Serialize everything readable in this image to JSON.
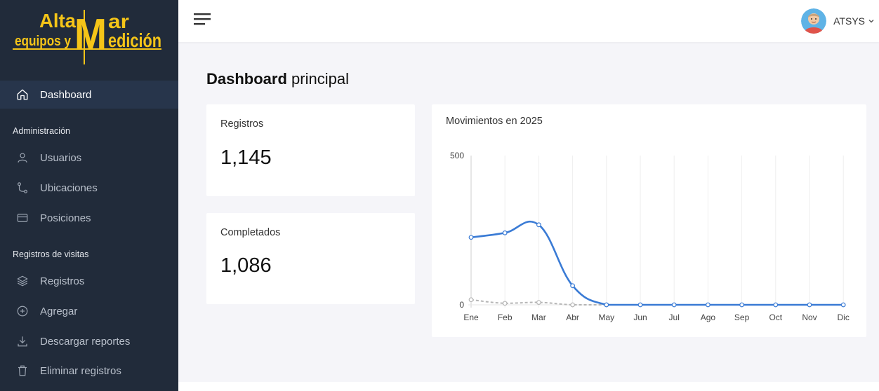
{
  "brand": {
    "line1": "Alta",
    "big_letter": "M",
    "line1_end": "ar",
    "line2_start": "equipos y",
    "line2_end": "edición",
    "color": "#f5c518"
  },
  "sidebar": {
    "items": [
      {
        "label": "Dashboard",
        "icon": "home-icon",
        "active": true
      },
      {
        "label": "Usuarios",
        "icon": "user-icon"
      },
      {
        "label": "Ubicaciones",
        "icon": "route-icon"
      },
      {
        "label": "Posiciones",
        "icon": "card-icon"
      },
      {
        "label": "Registros",
        "icon": "layers-icon"
      },
      {
        "label": "Agregar",
        "icon": "plus-circle-icon"
      },
      {
        "label": "Descargar reportes",
        "icon": "download-icon"
      },
      {
        "label": "Eliminar registros",
        "icon": "trash-icon"
      }
    ],
    "sections": {
      "admin": "Administración",
      "visits": "Registros de visitas"
    }
  },
  "header": {
    "user_name": "ATSYS"
  },
  "page": {
    "title_bold": "Dashboard",
    "title_rest": "principal"
  },
  "stats": {
    "registros": {
      "label": "Registros",
      "value": "1,145"
    },
    "completados": {
      "label": "Completados",
      "value": "1,086"
    }
  },
  "chart_data": {
    "type": "line",
    "title": "Movimientos en 2025",
    "categories": [
      "Ene",
      "Feb",
      "Mar",
      "Abr",
      "May",
      "Jun",
      "Jul",
      "Ago",
      "Sep",
      "Oct",
      "Nov",
      "Dic"
    ],
    "ylim": [
      0,
      500
    ],
    "yticks": [
      0,
      500
    ],
    "grid": true,
    "series": [
      {
        "values": [
          226,
          241,
          268,
          64,
          0,
          0,
          0,
          0,
          0,
          0,
          0,
          0
        ],
        "color": "#3a7bd5",
        "style": "solid"
      },
      {
        "values": [
          17,
          5,
          8,
          0,
          0,
          null,
          null,
          null,
          null,
          null,
          null,
          null
        ],
        "color": "#b5b5b5",
        "style": "dashed"
      }
    ]
  }
}
